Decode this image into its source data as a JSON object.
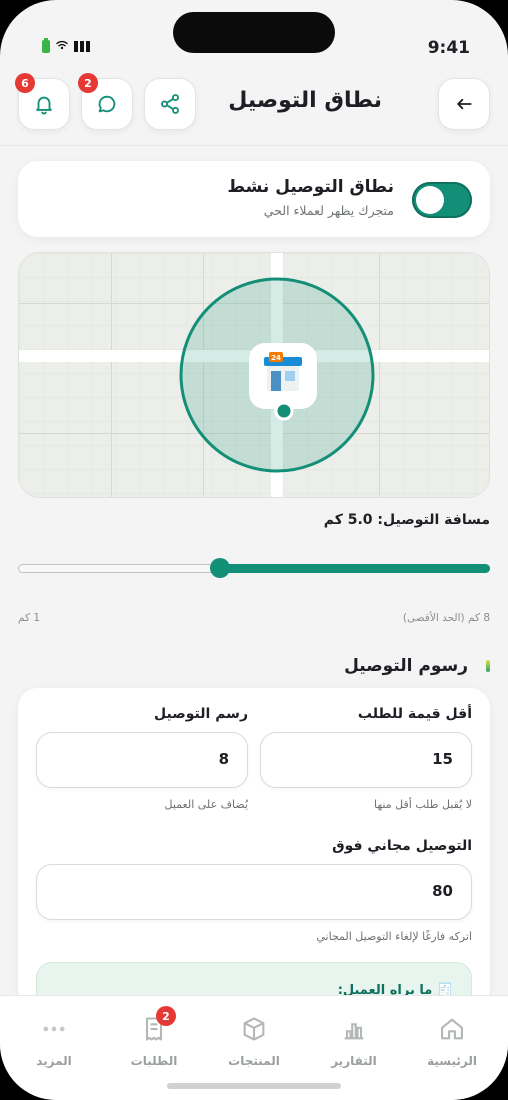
{
  "status": {
    "time": "9:41"
  },
  "header": {
    "title": "نطاق التوصيل",
    "notifications_count": "6",
    "messages_count": "2"
  },
  "delivery_toggle": {
    "title": "نطاق التوصيل نشط",
    "subtitle": "متجرك يظهر لعملاء الحي",
    "enabled": true
  },
  "map": {
    "store_icon": "store-24-icon"
  },
  "distance": {
    "label": "مسافة التوصيل: 5.0 كم",
    "value_km": 5.0,
    "min_km": 1,
    "max_km": 8,
    "min_label": "1 كم",
    "max_label": "8 كم (الحد الأقصى)"
  },
  "fees": {
    "section_title": "رسوم التوصيل",
    "min_order_label": "أقل قيمة للطلب",
    "min_order_value": "15",
    "min_order_hint": "لا يُقبل طلب أقل منها",
    "fee_label": "رسم التوصيل",
    "fee_value": "8",
    "fee_hint": "يُضاف على العميل",
    "free_label": "التوصيل مجاني فوق",
    "free_value": "80",
    "free_hint": "اتركه فارغًا لإلغاء التوصيل المجاني",
    "preview_title": "🧾 ما يراه العميل:"
  },
  "tabs": [
    {
      "label": "الرئيسية",
      "icon": "home-icon"
    },
    {
      "label": "التقارير",
      "icon": "reports-icon"
    },
    {
      "label": "المنتجات",
      "icon": "box-icon"
    },
    {
      "label": "الطلبات",
      "icon": "receipt-icon",
      "badge": "2"
    },
    {
      "label": "المزيد",
      "icon": "more-icon"
    }
  ],
  "colors": {
    "accent": "#138f77",
    "badge": "#e53935",
    "background": "#f3f4f3"
  }
}
